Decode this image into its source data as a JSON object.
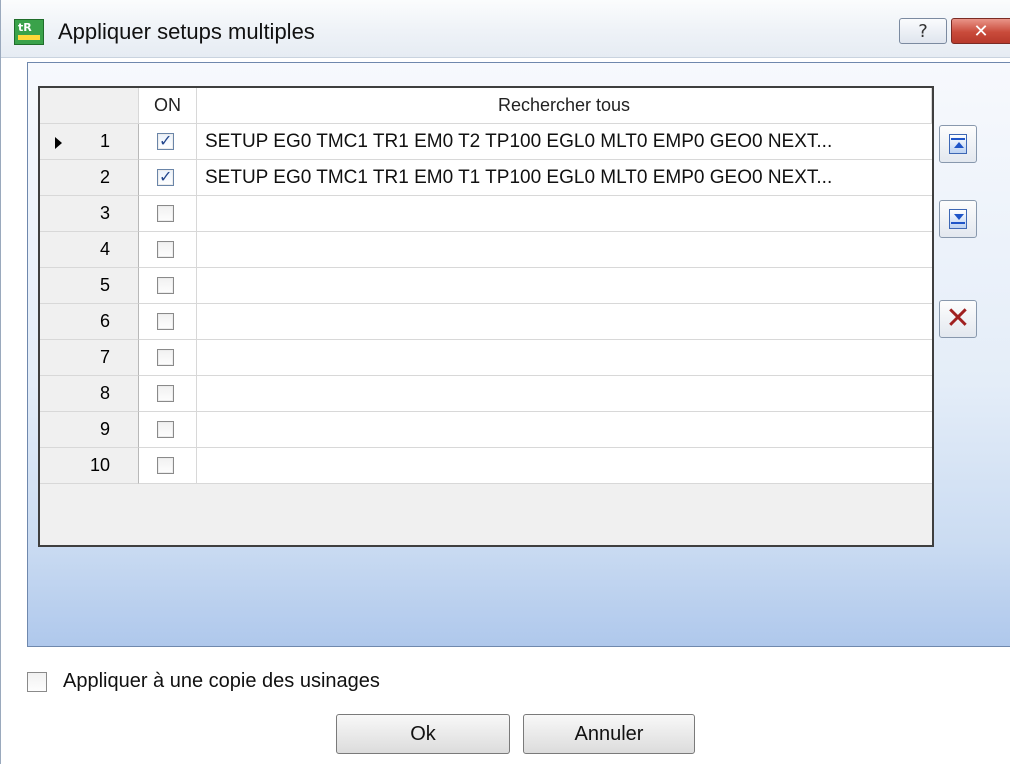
{
  "window": {
    "title": "Appliquer setups multiples"
  },
  "titlebar": {
    "help_glyph": "?",
    "close_glyph": "✕"
  },
  "grid": {
    "headers": {
      "on": "ON",
      "description": "Rechercher tous"
    },
    "rows": [
      {
        "num": "1",
        "current": true,
        "on": true,
        "text": "SETUP EG0 TMC1 TR1 EM0 T2 TP100 EGL0 MLT0 EMP0 GEO0 NEXT..."
      },
      {
        "num": "2",
        "current": false,
        "on": true,
        "text": "SETUP EG0 TMC1 TR1 EM0 T1 TP100 EGL0 MLT0 EMP0 GEO0 NEXT..."
      },
      {
        "num": "3",
        "current": false,
        "on": false,
        "text": ""
      },
      {
        "num": "4",
        "current": false,
        "on": false,
        "text": ""
      },
      {
        "num": "5",
        "current": false,
        "on": false,
        "text": ""
      },
      {
        "num": "6",
        "current": false,
        "on": false,
        "text": ""
      },
      {
        "num": "7",
        "current": false,
        "on": false,
        "text": ""
      },
      {
        "num": "8",
        "current": false,
        "on": false,
        "text": ""
      },
      {
        "num": "9",
        "current": false,
        "on": false,
        "text": ""
      },
      {
        "num": "10",
        "current": false,
        "on": false,
        "text": ""
      }
    ]
  },
  "side_buttons": {
    "move_up_icon": "move-up-icon",
    "move_down_icon": "move-down-icon",
    "delete_icon": "delete-icon",
    "delete_glyph": "✕"
  },
  "options": {
    "copy_label": "Appliquer à une copie des usinages",
    "copy_checked": false
  },
  "buttons": {
    "ok": "Ok",
    "cancel": "Annuler"
  },
  "colors": {
    "accent_check": "#22468c",
    "close_button": "#c94b3b",
    "panel_gradient_bottom": "#afc8ec"
  }
}
